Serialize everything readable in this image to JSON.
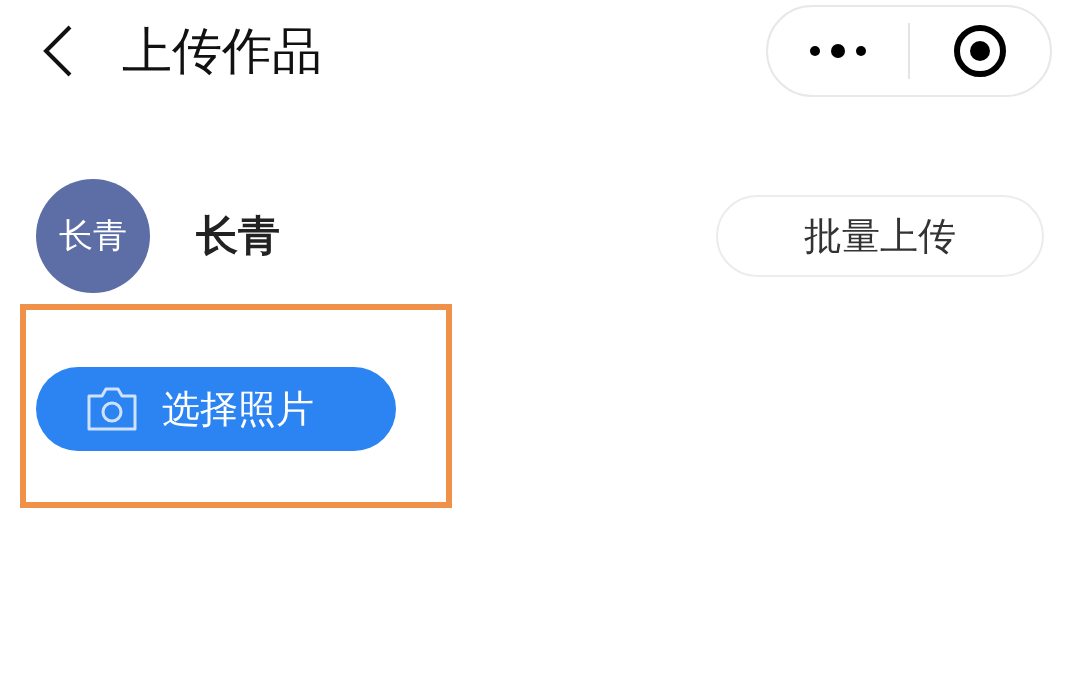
{
  "header": {
    "title": "上传作品"
  },
  "user": {
    "avatar_text": "长青",
    "name": "长青"
  },
  "batch_upload_button": {
    "label": "批量上传"
  },
  "select_section": {
    "highlighted": true,
    "button": {
      "label": "选择照片"
    }
  }
}
